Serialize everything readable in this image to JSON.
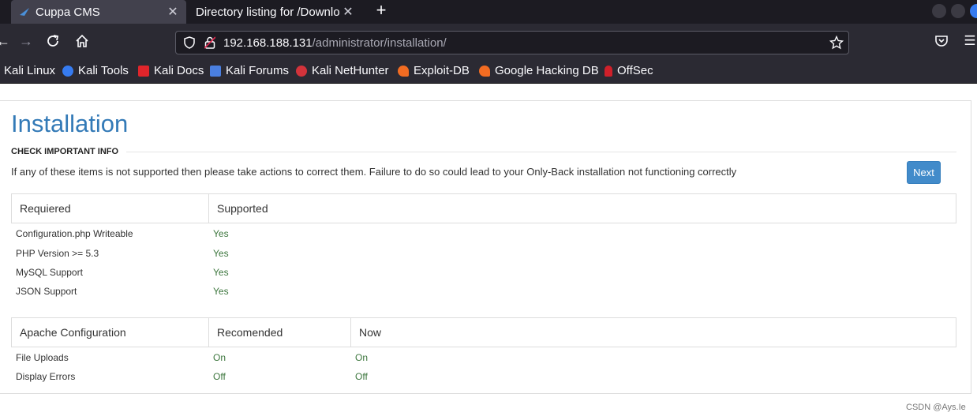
{
  "browser": {
    "tabs": [
      {
        "title": "Cuppa CMS",
        "active": true
      },
      {
        "title": "Directory listing for /Downloads",
        "active": false
      }
    ],
    "new_tab_label": "+",
    "url": {
      "host": "192.168.188.131",
      "path": "/administrator/installation/"
    },
    "bookmarks": [
      {
        "label": "Kali Linux",
        "icon": "kali-dragon-icon",
        "color": "#2b2a33"
      },
      {
        "label": "Kali Tools",
        "icon": "kali-tools-icon",
        "color": "#367bf0"
      },
      {
        "label": "Kali Docs",
        "icon": "kali-docs-icon",
        "color": "#e0252b"
      },
      {
        "label": "Kali Forums",
        "icon": "kali-forums-icon",
        "color": "#4a7fe0"
      },
      {
        "label": "Kali NetHunter",
        "icon": "nethunter-icon",
        "color": "#d3333b"
      },
      {
        "label": "Exploit-DB",
        "icon": "exploit-db-icon",
        "color": "#f26c22"
      },
      {
        "label": "Google Hacking DB",
        "icon": "ghdb-icon",
        "color": "#f26c22"
      },
      {
        "label": "OffSec",
        "icon": "offsec-icon",
        "color": "#d0202a"
      }
    ]
  },
  "page": {
    "title": "Installation",
    "section_label": "CHECK IMPORTANT INFO",
    "info_text": "If any of these items is not supported then please take actions to correct them. Failure to do so could lead to your Only-Back installation not functioning correctly",
    "next_label": "Next",
    "requirements": {
      "headers": [
        "Requiered",
        "Supported"
      ],
      "rows": [
        {
          "label": "Configuration.php Writeable",
          "supported": "Yes"
        },
        {
          "label": "PHP Version >= 5.3",
          "supported": "Yes"
        },
        {
          "label": "MySQL Support",
          "supported": "Yes"
        },
        {
          "label": "JSON Support",
          "supported": "Yes"
        }
      ]
    },
    "apache": {
      "headers": [
        "Apache Configuration",
        "Recomended",
        "Now"
      ],
      "rows": [
        {
          "label": "File Uploads",
          "recommended": "On",
          "now": "On"
        },
        {
          "label": "Display Errors",
          "recommended": "Off",
          "now": "Off"
        }
      ]
    }
  },
  "watermark": "CSDN @Ays.Ie",
  "colors": {
    "title_blue": "#337ab7",
    "button_blue": "#428bca",
    "value_green": "#3c763d"
  }
}
